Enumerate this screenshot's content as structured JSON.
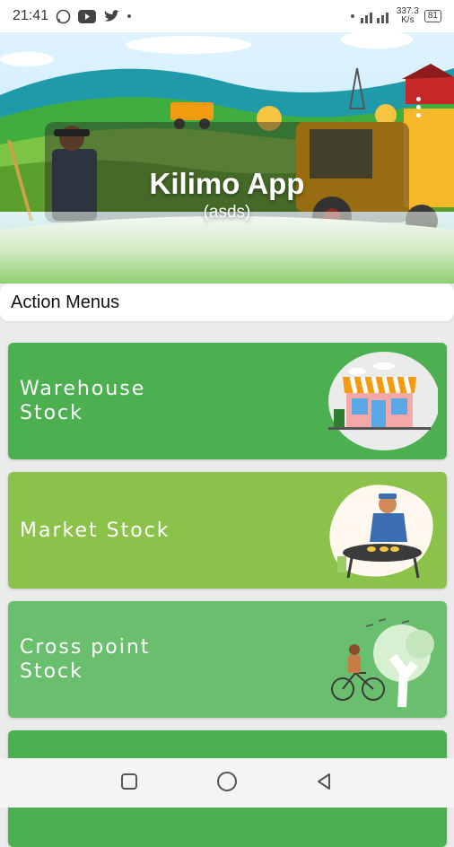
{
  "status": {
    "time": "21:41",
    "speed": "337.3\nK/s",
    "speed_value": "337.3",
    "speed_unit": "K/s",
    "battery": "81"
  },
  "header": {
    "title": "Kilimo App",
    "subtitle": "(asds)"
  },
  "section": {
    "title": "Action Menus"
  },
  "menu": [
    {
      "label_line1": "Warehouse",
      "label_line2": "Stock",
      "color": "#4caf50",
      "icon": "warehouse-shop-illustration"
    },
    {
      "label_line1": "Market Stock",
      "label_line2": "",
      "color": "#8bc34a",
      "icon": "market-vendor-illustration"
    },
    {
      "label_line1": "Cross point",
      "label_line2": "Stock",
      "color": "#6abf6f",
      "icon": "cyclist-tree-illustration"
    },
    {
      "label_line1": "",
      "label_line2": "",
      "color": "#4caf50",
      "icon": ""
    }
  ],
  "colors": {
    "green_primary": "#4caf50",
    "green_light": "#8bc34a",
    "green_medium": "#6abf6f"
  }
}
